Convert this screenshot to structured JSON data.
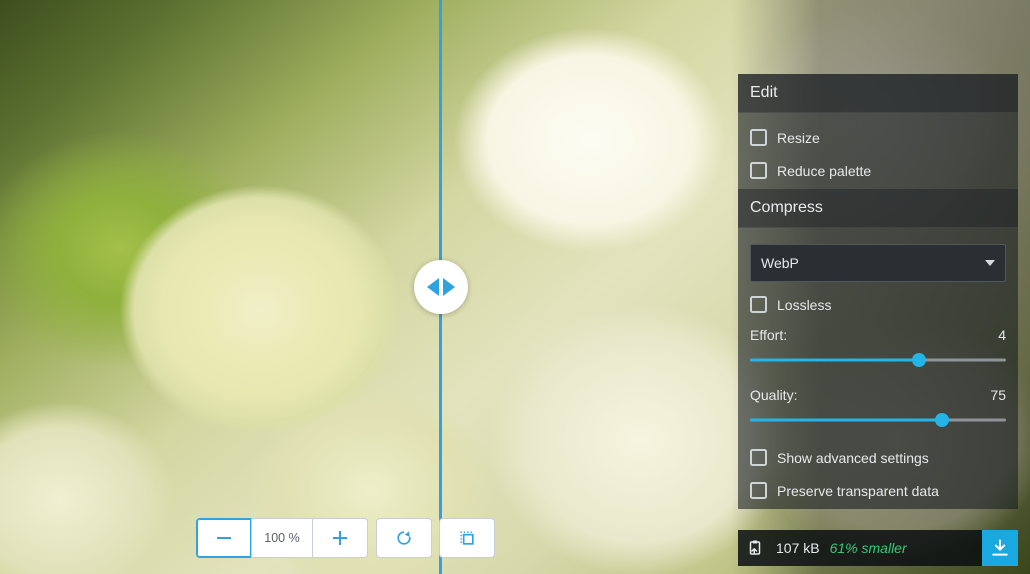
{
  "edit": {
    "title": "Edit",
    "resize": "Resize",
    "reduce_palette": "Reduce palette"
  },
  "compress": {
    "title": "Compress",
    "format_selected": "WebP",
    "lossless": "Lossless",
    "effort_label": "Effort:",
    "effort_value": "4",
    "effort_pct": 66,
    "quality_label": "Quality:",
    "quality_value": "75",
    "quality_pct": 75,
    "advanced": "Show advanced settings",
    "preserve_alpha": "Preserve transparent data"
  },
  "footer": {
    "size": "107 kB",
    "delta": "61% smaller"
  },
  "toolbar": {
    "zoom": "100 %"
  }
}
